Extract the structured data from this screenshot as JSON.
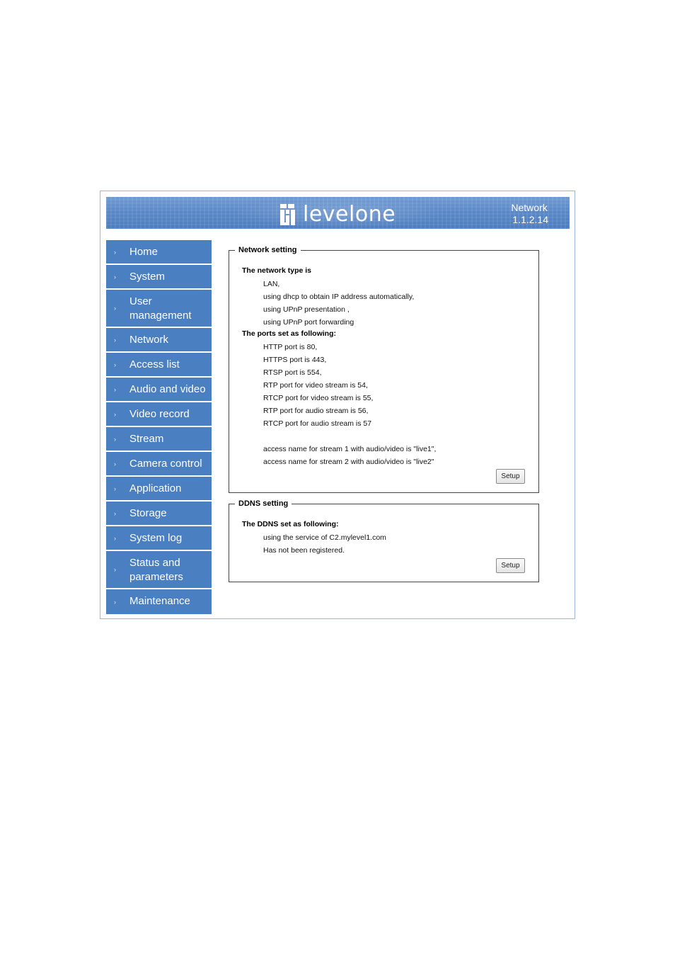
{
  "header": {
    "logo_text": "levelone",
    "section": "Network",
    "version": "1.1.2.14"
  },
  "sidebar": {
    "items": [
      {
        "label": "Home"
      },
      {
        "label": "System"
      },
      {
        "label": "User management",
        "line1": "User",
        "line2": "management"
      },
      {
        "label": "Network"
      },
      {
        "label": "Access list"
      },
      {
        "label": "Audio and video"
      },
      {
        "label": "Video record"
      },
      {
        "label": "Stream"
      },
      {
        "label": "Camera control"
      },
      {
        "label": "Application"
      },
      {
        "label": "Storage"
      },
      {
        "label": "System log"
      },
      {
        "label": "Status and parameters",
        "line1": "Status and",
        "line2": "parameters"
      },
      {
        "label": "Maintenance"
      }
    ],
    "arrow_glyph": "›"
  },
  "network_setting": {
    "legend": "Network setting",
    "type_heading": "The network type is",
    "type_lines": [
      "LAN,",
      "using dhcp to obtain IP address automatically,",
      "using UPnP presentation ,",
      "using UPnP port forwarding"
    ],
    "ports_heading": "The ports set as following:",
    "port_lines": [
      "HTTP port is 80,",
      "HTTPS port is 443,",
      "RTSP port is 554,",
      "RTP port for video stream is 54,",
      "RTCP port for video stream is 55,",
      "RTP port for audio stream is 56,",
      "RTCP port for audio stream is 57"
    ],
    "access_lines": [
      "access name for stream 1 with audio/video is \"live1\",",
      "access name for stream 2 with audio/video is \"live2\""
    ],
    "setup_label": "Setup"
  },
  "ddns_setting": {
    "legend": "DDNS setting",
    "heading": "The DDNS set as following:",
    "lines": [
      "using the service of C2.mylevel1.com",
      "Has not been registered."
    ],
    "setup_label": "Setup"
  },
  "colors": {
    "nav_bg": "#4a7fc1",
    "banner": "#5a88c7"
  }
}
